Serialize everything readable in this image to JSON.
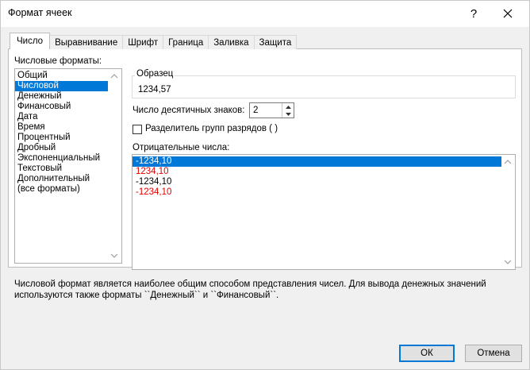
{
  "window": {
    "title": "Формат ячеек",
    "help_label": "?"
  },
  "tabs": [
    {
      "label": "Число",
      "active": true
    },
    {
      "label": "Выравнивание"
    },
    {
      "label": "Шрифт"
    },
    {
      "label": "Граница"
    },
    {
      "label": "Заливка"
    },
    {
      "label": "Защита"
    }
  ],
  "categories": {
    "label": "Числовые форматы:",
    "items": [
      "Общий",
      "Числовой",
      "Денежный",
      "Финансовый",
      "Дата",
      "Время",
      "Процентный",
      "Дробный",
      "Экспоненциальный",
      "Текстовый",
      "Дополнительный",
      "(все форматы)"
    ],
    "selected_index": 1
  },
  "sample": {
    "label": "Образец",
    "value": "1234,57"
  },
  "decimals": {
    "label": "Число десятичных знаков:",
    "value": "2"
  },
  "separator": {
    "label": "Разделитель групп разрядов ( )",
    "checked": false
  },
  "negatives": {
    "label": "Отрицательные числа:",
    "items": [
      {
        "text": "-1234,10",
        "color": "#000000"
      },
      {
        "text": "1234,10",
        "color": "#e00000"
      },
      {
        "text": "-1234,10",
        "color": "#000000"
      },
      {
        "text": "-1234,10",
        "color": "#e00000"
      }
    ],
    "selected_index": 0
  },
  "description": {
    "line1": "Числовой формат является наиболее общим способом представления чисел. Для вывода денежных значений",
    "line2": "используются также форматы ``Денежный`` и ``Финансовый``."
  },
  "buttons": {
    "ok": "ОК",
    "cancel": "Отмена"
  },
  "colors": {
    "accent": "#0078d7",
    "negative_red": "#e00000"
  }
}
